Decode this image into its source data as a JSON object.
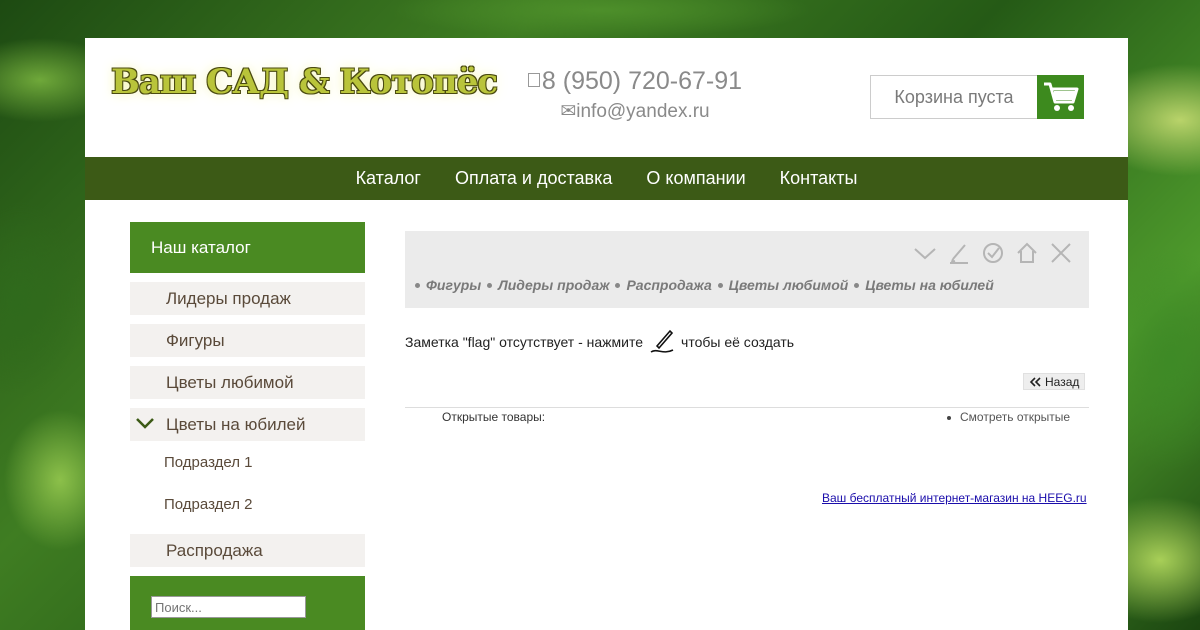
{
  "header": {
    "logo_text": "Ваш САД & Котопёс",
    "phone": "8 (950) 720-67-91",
    "email_icon": "✉",
    "email": "info@yandex.ru",
    "cart_label": "Корзина пуста",
    "cart_icon": "shopping-cart-icon"
  },
  "nav": {
    "items": [
      "Каталог",
      "Оплата и доставка",
      "О компании",
      "Контакты"
    ]
  },
  "sidebar": {
    "title": "Наш каталог",
    "items": [
      "Лидеры продаж",
      "Фигуры",
      "Цветы любимой",
      "Цветы на юбилей"
    ],
    "subitems": [
      "Подраздел 1",
      "Подраздел 2"
    ],
    "last_item": "Распродажа",
    "search_placeholder": "Поиск..."
  },
  "toolbar": {
    "icons": [
      "chevron-down-icon",
      "pencil-icon",
      "check-circle-icon",
      "home-icon",
      "close-icon"
    ],
    "crumbs": [
      "Фигуры",
      "Лидеры продаж",
      "Распродажа",
      "Цветы любимой",
      "Цветы на юбилей"
    ]
  },
  "content": {
    "note_before": "Заметка \"flag\" отсутствует - нажмите",
    "note_after": "чтобы её создать",
    "back_label": "Назад",
    "opened_label": "Открытые товары:",
    "opened_link": "Смотреть открытые",
    "footer_link": "Ваш бесплатный интернет-магазин на HEEG.ru"
  },
  "colors": {
    "brand_green": "#4a8a22",
    "nav_green": "#3c5a16",
    "cart_green": "#3d8a1e"
  }
}
